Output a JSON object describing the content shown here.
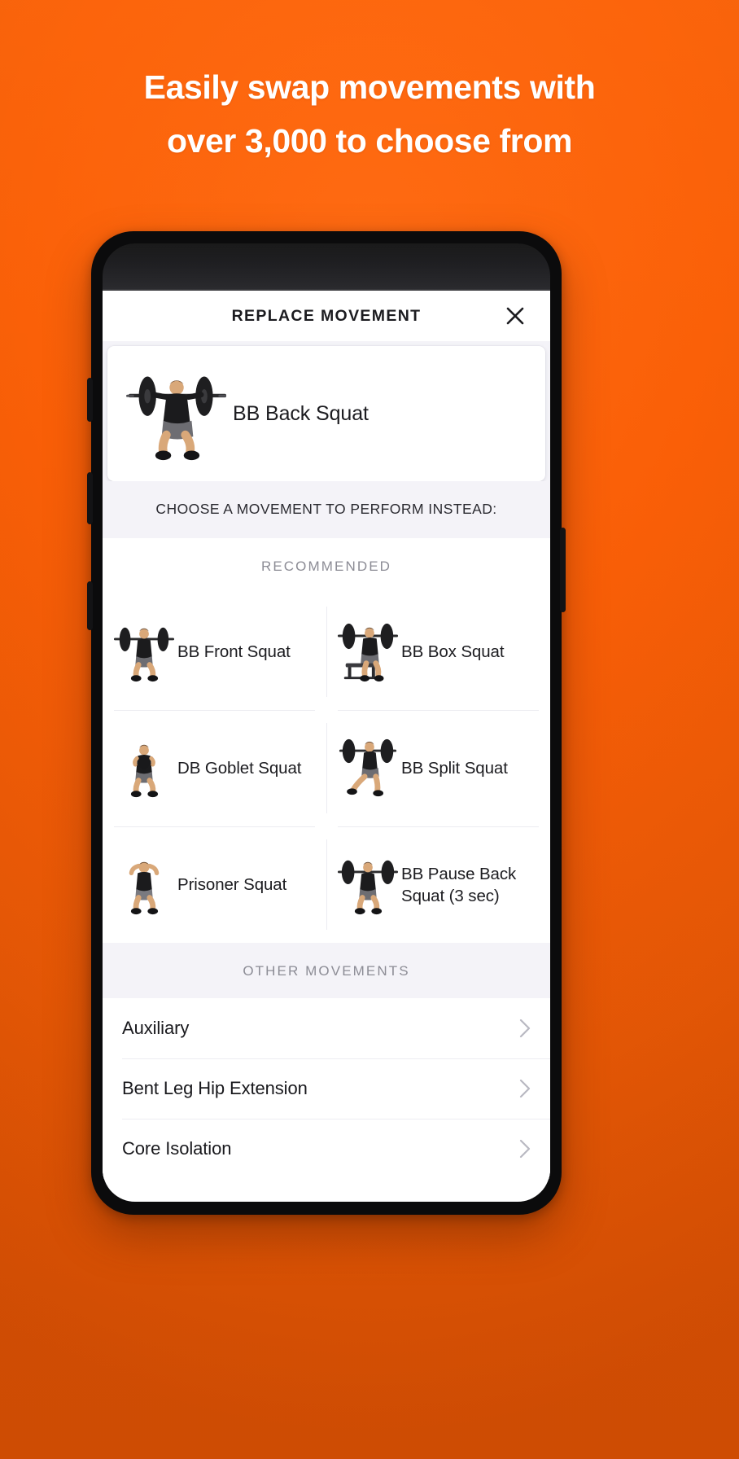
{
  "promo": {
    "headline_line1": "Easily swap movements with",
    "headline_line2": "over 3,000 to choose from",
    "background_color": "#F4660C",
    "headline_color": "#FFFFFF"
  },
  "app": {
    "header": {
      "title": "REPLACE MOVEMENT",
      "close_icon": "close-icon"
    },
    "current_movement": {
      "name": "BB Back Squat",
      "figure": "barbell-back-squat-figure"
    },
    "instruction": "CHOOSE A MOVEMENT TO PERFORM INSTEAD:",
    "recommended": {
      "section_label": "RECOMMENDED",
      "items": [
        {
          "name": "BB Front Squat",
          "figure": "barbell-front-squat-figure"
        },
        {
          "name": "BB Box Squat",
          "figure": "barbell-box-squat-figure"
        },
        {
          "name": "DB Goblet Squat",
          "figure": "dumbbell-goblet-squat-figure"
        },
        {
          "name": "BB Split Squat",
          "figure": "barbell-split-squat-figure"
        },
        {
          "name": "Prisoner Squat",
          "figure": "prisoner-squat-figure"
        },
        {
          "name": "BB Pause Back Squat (3 sec)",
          "figure": "barbell-pause-back-squat-figure"
        }
      ]
    },
    "other_movements": {
      "section_label": "OTHER MOVEMENTS",
      "items": [
        {
          "label": "Auxiliary",
          "chevron": "chevron-right-icon"
        },
        {
          "label": "Bent Leg Hip Extension",
          "chevron": "chevron-right-icon"
        },
        {
          "label": "Core Isolation",
          "chevron": "chevron-right-icon"
        }
      ]
    },
    "colors": {
      "panel_tint": "#F4F3F8",
      "card_white": "#FFFFFF",
      "section_label": "#8C8C95",
      "text_primary": "#1C1C20",
      "chevron": "#B9B9C2"
    }
  }
}
